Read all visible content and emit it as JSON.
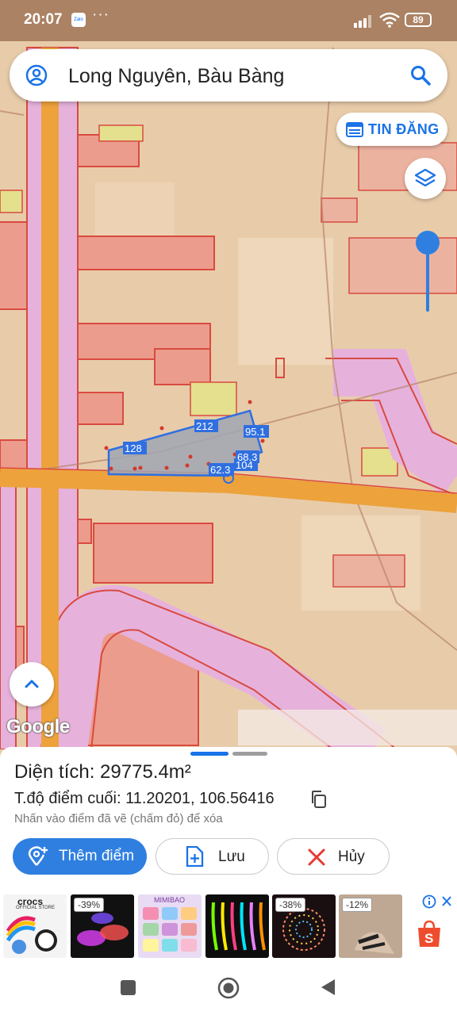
{
  "status_bar": {
    "time": "20:07",
    "app_badge": "Zalo",
    "more": "···",
    "battery": "89"
  },
  "search": {
    "title": "Long Nguyên, Bàu Bàng"
  },
  "top_button": {
    "label": "TIN ĐĂNG"
  },
  "map": {
    "attribution": "Google",
    "parcel_edges": [
      "212",
      "95.1",
      "128",
      "68.3",
      "62.3",
      "104"
    ],
    "colors": {
      "land": "#e8ccaa",
      "residential": "#ec9c8c",
      "road": "#e2ab9c",
      "transport": "#e6b2dc",
      "highway": "#eda23c",
      "green": "#e4e08e",
      "parcel_fill": "#a0a4b4",
      "parcel_line": "#2f6fe0",
      "points": "#d23a2a"
    }
  },
  "info": {
    "area": "Diện tích: 29775.4m²",
    "last_point": "T.độ điểm cuối: 11.20201, 106.56416",
    "hint": "Nhấn vào điểm đã vẽ (chấm đỏ) để xóa"
  },
  "actions": {
    "add_point": "Thêm điểm",
    "save": "Lưu",
    "cancel": "Hủy"
  },
  "ads": [
    {
      "brand": "crocs",
      "sub": "OFFICIAL STORE"
    },
    {
      "discount": "-39%"
    },
    {
      "brand": "MIMIBAO"
    },
    {},
    {
      "discount": "-38%"
    },
    {
      "discount": "-12%"
    }
  ]
}
